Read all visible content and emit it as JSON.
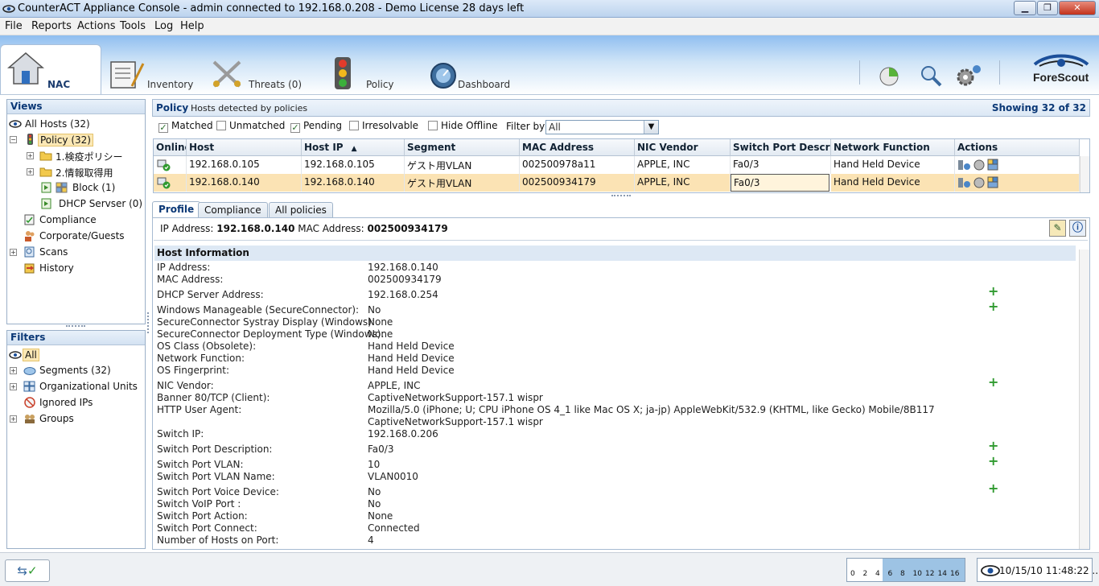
{
  "window": {
    "title": "CounterACT Appliance Console - admin connected to 192.168.0.208 - Demo License 28 days left"
  },
  "menu": [
    "File",
    "Reports",
    "Actions",
    "Tools",
    "Log",
    "Help"
  ],
  "tabs": {
    "nac": "NAC",
    "inventory": "Inventory",
    "threats": "Threats (0)",
    "policy": "Policy",
    "dashboard": "Dashboard"
  },
  "brand": "ForeScout",
  "views": {
    "title": "Views",
    "all_hosts": "All Hosts (32)",
    "policy": "Policy (32)",
    "policy_1": "1.検疫ポリシー",
    "policy_2": "2.情報取得用",
    "block": "Block (1)",
    "dhcp": "DHCP Servser (0)",
    "compliance": "Compliance",
    "corporate": "Corporate/Guests",
    "scans": "Scans",
    "history": "History"
  },
  "filters": {
    "title": "Filters",
    "all": "All",
    "segments": "Segments (32)",
    "org_units": "Organizational Units",
    "ignored": "Ignored IPs",
    "groups": "Groups"
  },
  "policy_panel": {
    "title": "Policy",
    "subtitle": "Hosts detected by policies",
    "showing": "Showing 32 of 32",
    "checks": {
      "matched": "Matched",
      "unmatched": "Unmatched",
      "pending": "Pending",
      "irresolvable": "Irresolvable",
      "hide_offline": "Hide Offline"
    },
    "filter_by_label": "Filter by",
    "filter_value": "All"
  },
  "grid": {
    "headers": [
      "Online",
      "Host",
      "Host IP",
      "Segment",
      "MAC Address",
      "NIC Vendor",
      "Switch Port Descripti",
      "Network Function",
      "Actions"
    ],
    "rows": [
      {
        "host": "192.168.0.105",
        "ip": "192.168.0.105",
        "segment": "ゲスト用VLAN",
        "mac": "002500978a11",
        "vendor": "APPLE, INC",
        "port": "Fa0/3",
        "function": "Hand Held Device"
      },
      {
        "host": "192.168.0.140",
        "ip": "192.168.0.140",
        "segment": "ゲスト用VLAN",
        "mac": "002500934179",
        "vendor": "APPLE, INC",
        "port": "Fa0/3",
        "function": "Hand Held Device"
      }
    ]
  },
  "subtabs": {
    "profile": "Profile",
    "compliance": "Compliance",
    "all_policies": "All policies"
  },
  "profile": {
    "ip_label": "IP Address:",
    "ip": "192.168.0.140",
    "mac_label": "MAC Address:",
    "mac": "002500934179",
    "section": "Host Information",
    "fields": [
      {
        "label": "IP Address:",
        "value": "192.168.0.140"
      },
      {
        "label": "MAC Address:",
        "value": "002500934179"
      },
      {
        "label": "DHCP Server Address:",
        "value": "192.168.0.254"
      },
      {
        "label": "Windows Manageable (SecureConnector):",
        "value": "No"
      },
      {
        "label": "SecureConnector Systray Display (Windows):",
        "value": "None"
      },
      {
        "label": "SecureConnector Deployment Type (Windows):",
        "value": "None"
      },
      {
        "label": "OS Class (Obsolete):",
        "value": "Hand Held Device"
      },
      {
        "label": "Network Function:",
        "value": "Hand Held Device"
      },
      {
        "label": "OS Fingerprint:",
        "value": "Hand Held Device"
      },
      {
        "label": "NIC Vendor:",
        "value": "APPLE, INC"
      },
      {
        "label": "Banner 80/TCP (Client):",
        "value": "CaptiveNetworkSupport-157.1 wispr"
      },
      {
        "label": "HTTP User Agent:",
        "value": "Mozilla/5.0 (iPhone; U; CPU iPhone OS 4_1 like Mac OS X; ja-jp) AppleWebKit/532.9 (KHTML, like Gecko) Mobile/8B117"
      },
      {
        "label": "",
        "value": "CaptiveNetworkSupport-157.1 wispr"
      },
      {
        "label": "Switch IP:",
        "value": "192.168.0.206"
      },
      {
        "label": "Switch Port Description:",
        "value": "Fa0/3"
      },
      {
        "label": "Switch Port VLAN:",
        "value": "10"
      },
      {
        "label": "Switch Port VLAN Name:",
        "value": "VLAN0010"
      },
      {
        "label": "Switch Port Voice Device:",
        "value": "No"
      },
      {
        "label": "Switch VoIP Port :",
        "value": "No"
      },
      {
        "label": "Switch Port Action:",
        "value": "None"
      },
      {
        "label": "Switch Port Connect:",
        "value": "Connected"
      },
      {
        "label": "Number of Hosts on Port:",
        "value": "4"
      }
    ]
  },
  "status": {
    "ticks": [
      "0",
      "2",
      "4",
      "6",
      "8",
      "10",
      "12",
      "14",
      "16"
    ],
    "datetime": "10/15/10 11:48:22 ..."
  }
}
